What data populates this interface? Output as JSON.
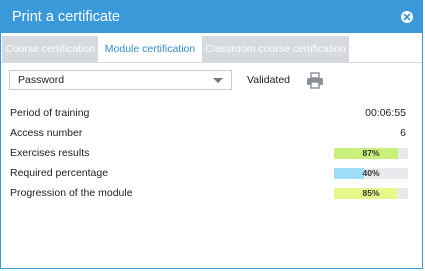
{
  "window": {
    "title": "Print a certificate"
  },
  "tabs": [
    {
      "label": "Course certification",
      "active": false
    },
    {
      "label": "Module certification",
      "active": true
    },
    {
      "label": "Classroom course certification",
      "active": false
    }
  ],
  "controls": {
    "document_select": "Password",
    "status": "Validated"
  },
  "details": [
    {
      "label": "Period of training",
      "value": "00:06:55"
    },
    {
      "label": "Access number",
      "value": "6"
    },
    {
      "label": "Exercises results",
      "bar": {
        "percent": 87,
        "text": "87%",
        "color": "#c8f07a"
      }
    },
    {
      "label": "Required percentage",
      "bar": {
        "percent": 40,
        "text": "40%",
        "color": "#9fdcf5"
      }
    },
    {
      "label": "Progression of the module",
      "bar": {
        "percent": 85,
        "text": "85%",
        "color": "#e7f78a"
      }
    }
  ],
  "colors": {
    "accent": "#3a9ad9",
    "tab_inactive": "#d6d9dd"
  },
  "icons": {
    "close": "close-circle-icon",
    "print": "printer-icon"
  }
}
